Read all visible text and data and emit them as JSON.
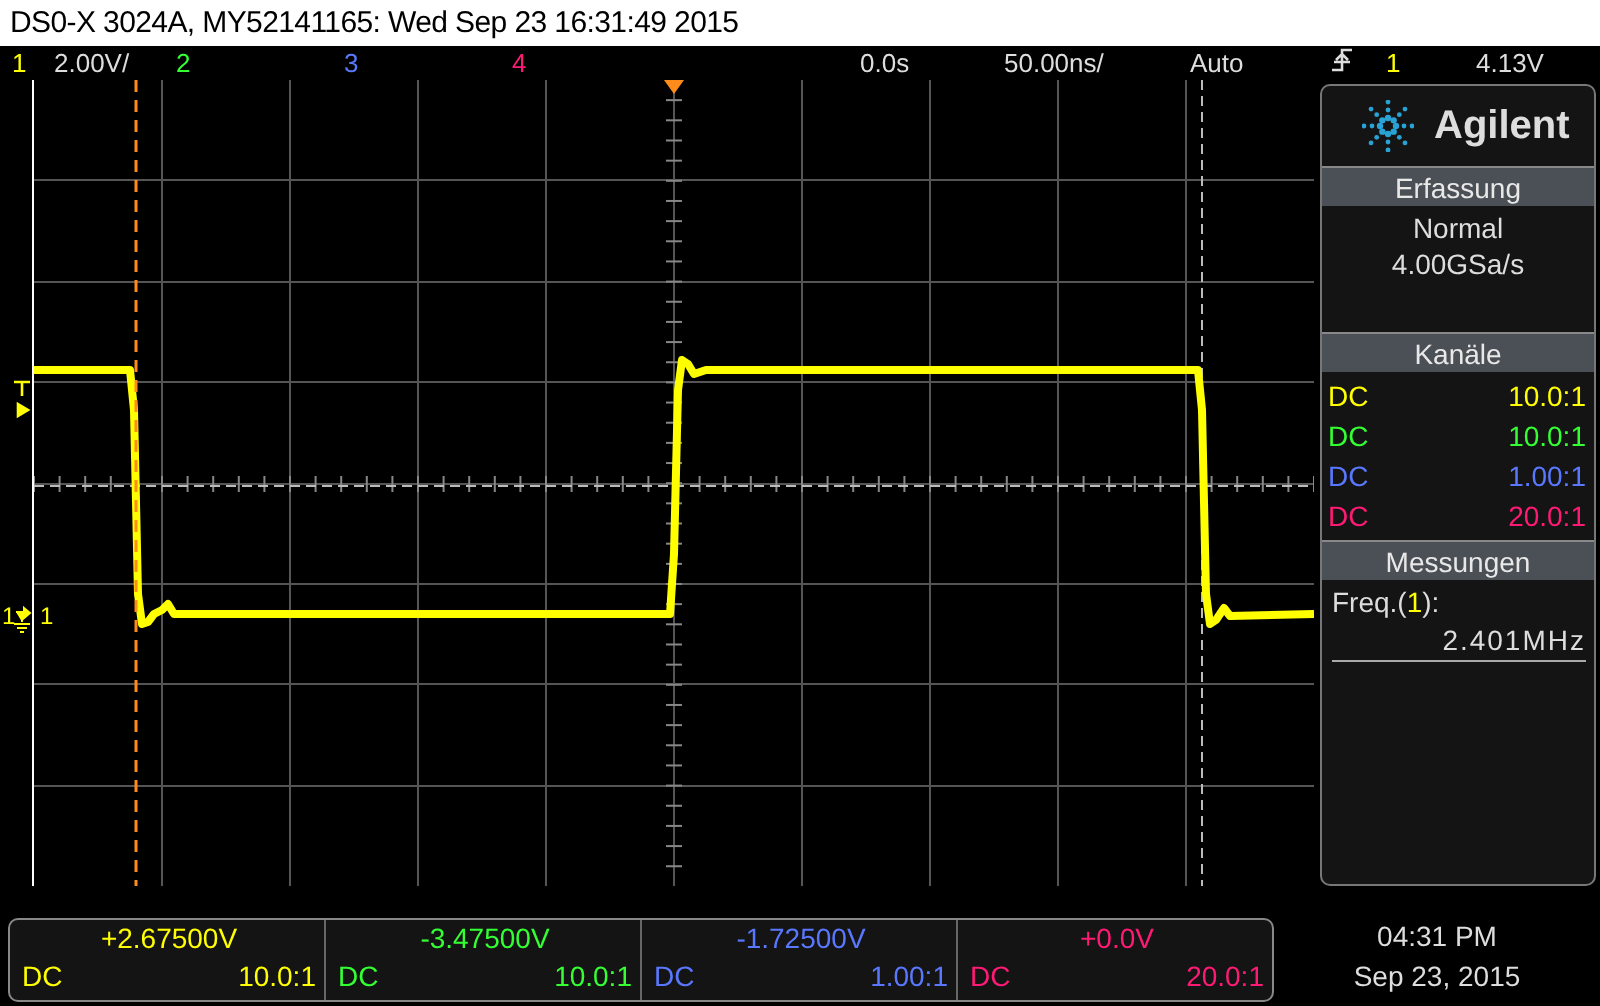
{
  "title": "DS0-X 3024A, MY52141165: Wed Sep 23 16:31:49 2015",
  "top_bar": {
    "channels": [
      {
        "label": "1",
        "scale": "2.00V/",
        "color": "#ffff00"
      },
      {
        "label": "2",
        "color": "#33ff33"
      },
      {
        "label": "3",
        "color": "#5a78ff"
      },
      {
        "label": "4",
        "color": "#ff1a75"
      }
    ],
    "time_offset": "0.0s",
    "timebase": "50.00ns/",
    "trigger_mode": "Auto",
    "trigger_source": "1",
    "trigger_level": "4.13V"
  },
  "scope": {
    "ground_marker": "1",
    "channel_label": "1"
  },
  "panel": {
    "brand": "Agilent",
    "sections": [
      {
        "title": "Erfassung",
        "kind": "lines",
        "lines": [
          "Normal",
          "4.00GSa/s"
        ]
      },
      {
        "title": "Kanäle",
        "kind": "channels",
        "channels": [
          {
            "coupling": "DC",
            "probe": "10.0:1",
            "color": "#ffff00"
          },
          {
            "coupling": "DC",
            "probe": "10.0:1",
            "color": "#33ff33"
          },
          {
            "coupling": "DC",
            "probe": "1.00:1",
            "color": "#5a78ff"
          },
          {
            "coupling": "DC",
            "probe": "20.0:1",
            "color": "#ff1a75"
          }
        ]
      },
      {
        "title": "Messungen",
        "kind": "measurement",
        "label": "Freq.(",
        "source": "1",
        "label_end": "):",
        "value": "2.401MHz"
      }
    ]
  },
  "bottom": {
    "channels": [
      {
        "offset": "+2.67500V",
        "coupling": "DC",
        "probe": "10.0:1",
        "color": "#ffff00"
      },
      {
        "offset": "-3.47500V",
        "coupling": "DC",
        "probe": "10.0:1",
        "color": "#33ff33"
      },
      {
        "offset": "-1.72500V",
        "coupling": "DC",
        "probe": "1.00:1",
        "color": "#5a78ff"
      },
      {
        "offset": "+0.0V",
        "coupling": "DC",
        "probe": "20.0:1",
        "color": "#ff1a75"
      }
    ],
    "time": "04:31 PM",
    "date": "Sep 23, 2015"
  }
}
